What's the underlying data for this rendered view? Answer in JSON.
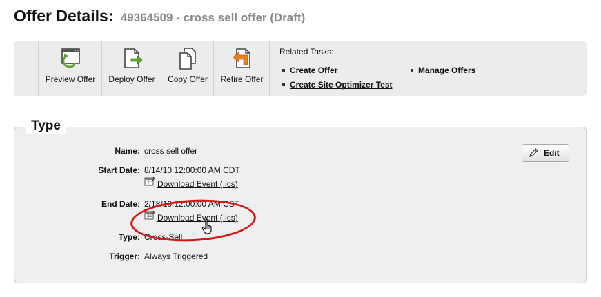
{
  "header": {
    "title": "Offer Details:",
    "subtitle": "49364509 - cross sell offer (Draft)"
  },
  "toolbar": {
    "buttons": [
      {
        "label": "Preview Offer",
        "icon": "preview-icon"
      },
      {
        "label": "Deploy Offer",
        "icon": "deploy-icon"
      },
      {
        "label": "Copy Offer",
        "icon": "copy-icon"
      },
      {
        "label": "Retire Offer",
        "icon": "retire-icon"
      }
    ],
    "related_tasks": {
      "heading": "Related Tasks:",
      "links": [
        "Create Offer",
        "Create Site Optimizer Test",
        "Manage Offers"
      ]
    }
  },
  "type_panel": {
    "legend": "Type",
    "edit_label": "Edit",
    "fields": {
      "name_label": "Name:",
      "name_value": "cross sell offer",
      "start_label": "Start Date:",
      "start_value": "8/14/10 12:00:00 AM CDT",
      "start_download": "Download Event (.ics)",
      "end_label": "End Date:",
      "end_value": "2/18/10 12:00:00 AM CST",
      "end_download": "Download Event (.ics)",
      "type_label": "Type:",
      "type_value": "Cross-Sell",
      "trigger_label": "Trigger:",
      "trigger_value": "Always Triggered"
    }
  },
  "colors": {
    "toolbar_bg": "#ececec",
    "panel_bg": "#efefef",
    "highlight": "#d91414",
    "deploy_arrow": "#5aa832",
    "retire_arrow": "#e8801c"
  }
}
